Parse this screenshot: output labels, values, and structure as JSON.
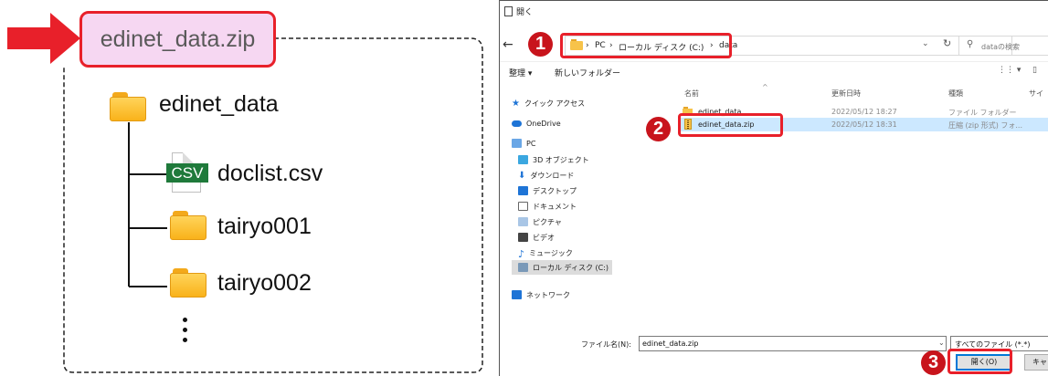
{
  "tree": {
    "zip_label": "edinet_data.zip",
    "root_folder": "edinet_data",
    "csv_badge": "CSV",
    "csv_file": "doclist.csv",
    "folder1": "tairyo001",
    "folder2": "tairyo002",
    "colors": {
      "arrow": "#e8202a",
      "zip_box_fill": "#f6d7f2",
      "zip_box_border": "#e8202a"
    }
  },
  "dialog": {
    "title": "開く",
    "breadcrumb": [
      "PC",
      "ローカル ディスク (C:)",
      "data"
    ],
    "search_placeholder": "dataの検索",
    "toolbar": {
      "organize": "整理 ▾",
      "new_folder": "新しいフォルダー"
    },
    "nav": [
      "クイック アクセス",
      "OneDrive",
      "PC",
      "3D オブジェクト",
      "ダウンロード",
      "デスクトップ",
      "ドキュメント",
      "ピクチャ",
      "ビデオ",
      "ミュージック",
      "ローカル ディスク (C:)",
      "ネットワーク"
    ],
    "columns": [
      "名前",
      "更新日時",
      "種類",
      "サイ"
    ],
    "files": [
      {
        "name": "edinet_data",
        "date": "2022/05/12 18:27",
        "type": "ファイル フォルダー"
      },
      {
        "name": "edinet_data.zip",
        "date": "2022/05/12 18:31",
        "type": "圧縮 (zip 形式) フォ..."
      }
    ],
    "filename_label": "ファイル名(N):",
    "filename_value": "edinet_data.zip",
    "filter": "すべてのファイル (*.*)",
    "open_button": "開く(O)",
    "cancel_button": "キャン"
  },
  "badges": {
    "one": "1",
    "two": "2",
    "three": "3"
  }
}
